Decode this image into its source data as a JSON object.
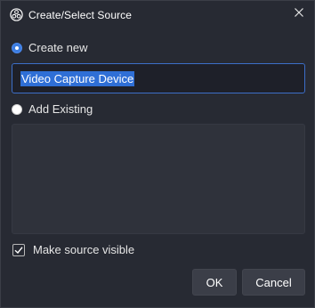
{
  "window": {
    "title": "Create/Select Source",
    "app_icon": "obs-logo-icon",
    "close_icon": "close-icon"
  },
  "options": {
    "create_new": {
      "label": "Create new",
      "checked": true
    },
    "add_existing": {
      "label": "Add Existing",
      "checked": false
    }
  },
  "name_input": {
    "value": "Video Capture Device",
    "selected": true
  },
  "existing_sources": [],
  "visibility": {
    "label": "Make source visible",
    "checked": true
  },
  "buttons": {
    "ok_label": "OK",
    "cancel_label": "Cancel"
  },
  "colors": {
    "background": "#272a33",
    "accent": "#3d7de0",
    "selection": "#2f6fd6",
    "button": "#3b3e48"
  }
}
